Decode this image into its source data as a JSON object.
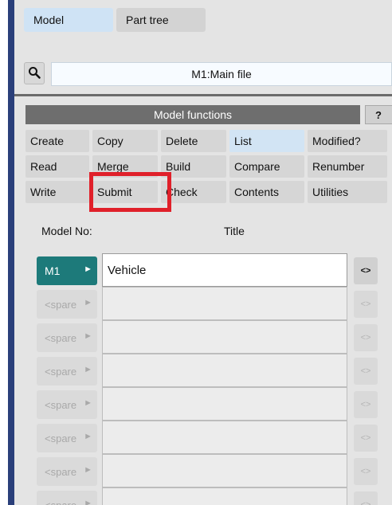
{
  "tabs": [
    {
      "label": "Model",
      "active": true
    },
    {
      "label": "Part tree",
      "active": false
    }
  ],
  "file": {
    "label": "M1:Main file"
  },
  "functions": {
    "header": "Model functions",
    "help_label": "?",
    "buttons": [
      "Create",
      "Copy",
      "Delete",
      "List",
      "Modified?",
      "Read",
      "Merge",
      "Build",
      "Compare",
      "Renumber",
      "Write",
      "Submit",
      "Check",
      "Contents",
      "Utilities"
    ]
  },
  "columns": {
    "model_no": "Model No:",
    "title": "Title"
  },
  "models": [
    {
      "id": "M1",
      "title": "Vehicle",
      "active": true
    },
    {
      "id": "<spare",
      "title": "",
      "active": false
    },
    {
      "id": "<spare",
      "title": "",
      "active": false
    },
    {
      "id": "<spare",
      "title": "",
      "active": false
    },
    {
      "id": "<spare",
      "title": "",
      "active": false
    },
    {
      "id": "<spare",
      "title": "",
      "active": false
    },
    {
      "id": "<spare",
      "title": "",
      "active": false
    },
    {
      "id": "<spare",
      "title": "",
      "active": false
    }
  ],
  "row_arrow": "►",
  "swap_label": "<>",
  "colors": {
    "accent": "#1d7a7a",
    "highlight_box": "#e0202a",
    "header": "#6e6e6e"
  },
  "icons": {
    "search": "magnifier-icon"
  }
}
